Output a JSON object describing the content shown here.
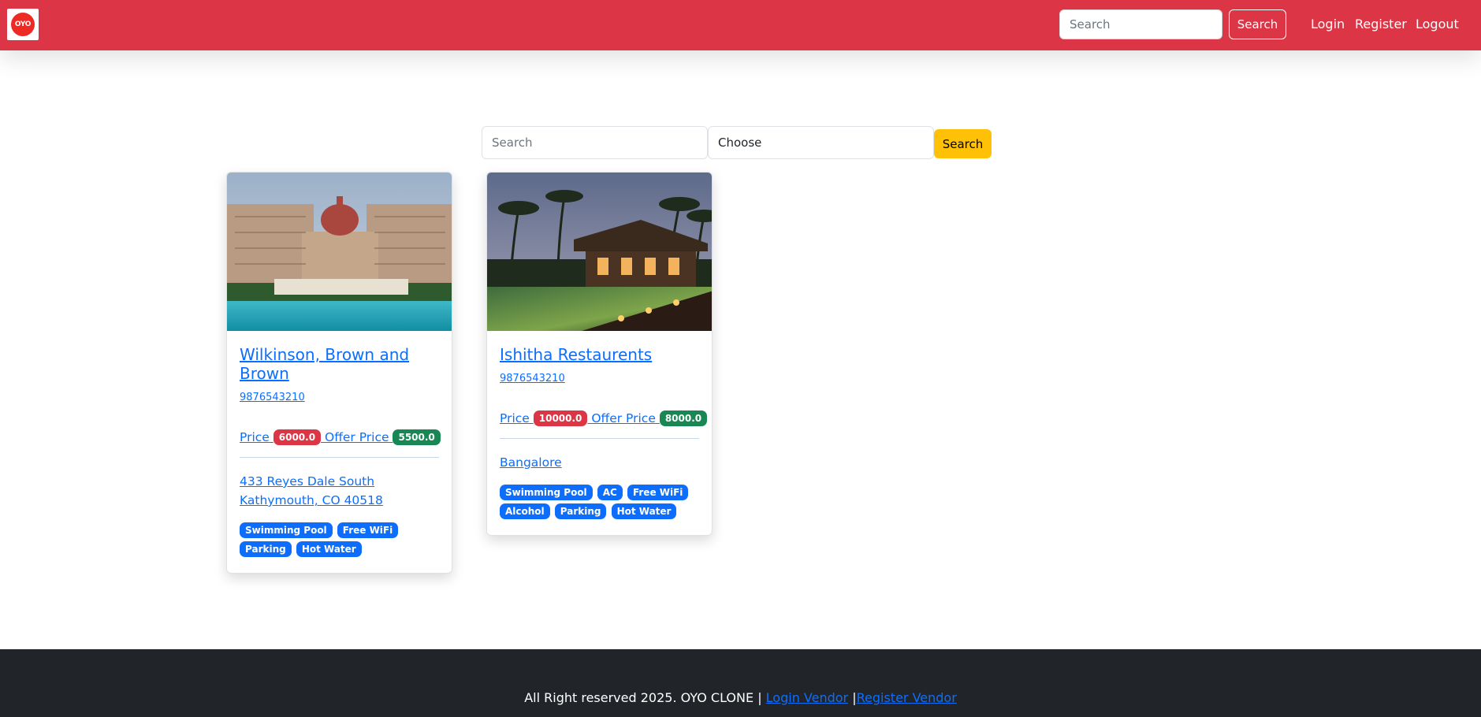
{
  "navbar": {
    "logo_text": "OYO",
    "search_placeholder": "Search",
    "search_button": "Search",
    "links": [
      "Login",
      "Register",
      "Logout"
    ],
    "color": "#dc3545"
  },
  "filter": {
    "search_placeholder": "Search",
    "select_value": "Choose",
    "button": "Search",
    "button_color": "#ffc107"
  },
  "hotels": [
    {
      "name": "Wilkinson, Brown and Brown",
      "phone": "9876543210",
      "price_label": "Price",
      "price": "6000.0",
      "offer_label": "Offer Price",
      "offer_price": "5500.0",
      "address": "433 Reyes Dale South Kathymouth, CO 40518",
      "amenities": [
        "Swimming Pool",
        "Free WiFi",
        "Parking",
        "Hot Water"
      ]
    },
    {
      "name": "Ishitha Restaurents",
      "phone": "9876543210",
      "price_label": "Price",
      "price": "10000.0",
      "offer_label": "Offer Price",
      "offer_price": "8000.0",
      "address": "Bangalore",
      "amenities": [
        "Swimming Pool",
        "AC",
        "Free WiFi",
        "Alcohol",
        "Parking",
        "Hot Water"
      ]
    }
  ],
  "footer": {
    "text": "All Right reserved 2025. OYO CLONE |",
    "login_vendor": "Login Vendor",
    "separator": "|",
    "register_vendor": "Register Vendor"
  }
}
